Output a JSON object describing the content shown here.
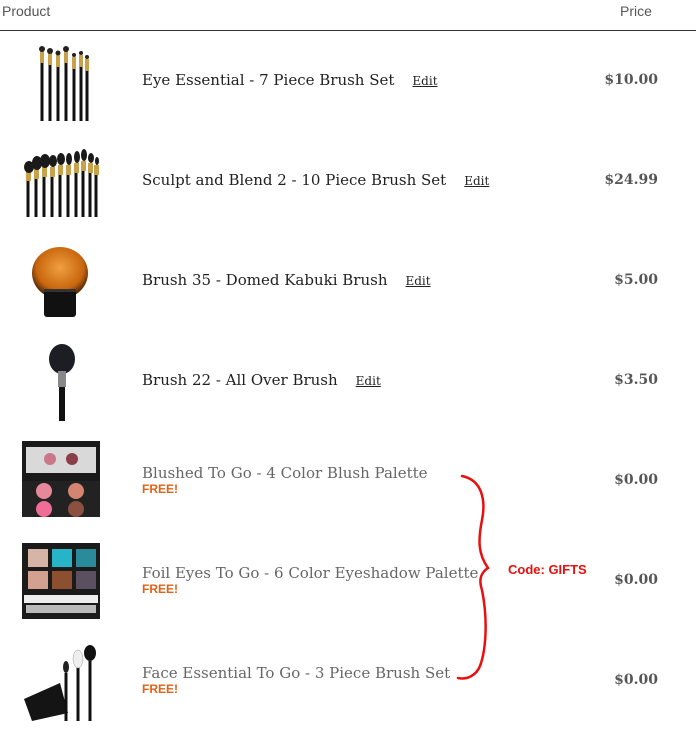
{
  "header": {
    "product_label": "Product",
    "price_label": "Price"
  },
  "items": [
    {
      "name": "Eye Essential - 7 Piece Brush Set",
      "edit": "Edit",
      "price": "$10.00"
    },
    {
      "name": "Sculpt and Blend 2 - 10 Piece Brush Set",
      "edit": "Edit",
      "price": "$24.99"
    },
    {
      "name": "Brush 35 - Domed Kabuki Brush",
      "edit": "Edit",
      "price": "$5.00"
    },
    {
      "name": "Brush 22 - All Over Brush",
      "edit": "Edit",
      "price": "$3.50"
    },
    {
      "name": "Blushed To Go - 4 Color Blush Palette",
      "badge": "FREE!",
      "price": "$0.00"
    },
    {
      "name": "Foil Eyes To Go - 6 Color Eyeshadow Palette",
      "badge": "FREE!",
      "price": "$0.00"
    },
    {
      "name": "Face Essential To Go - 3 Piece Brush Set",
      "badge": "FREE!",
      "price": "$0.00"
    }
  ],
  "annotation": {
    "text": "Code: GIFTS",
    "color": "#e8100e"
  },
  "colors": {
    "free": "#e0621a",
    "price": "#555555",
    "header_rule": "#333333"
  }
}
